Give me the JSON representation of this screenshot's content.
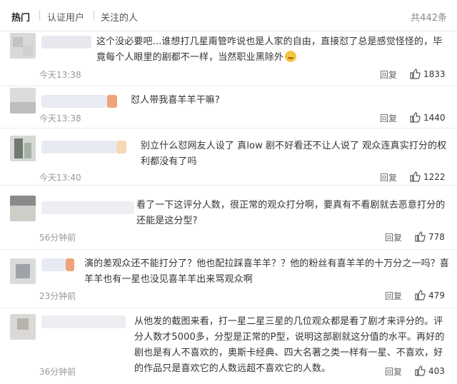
{
  "tabs": {
    "hot": "热门",
    "verified": "认证用户",
    "following": "关注的人",
    "total": "共442条"
  },
  "comments": [
    {
      "text": "这个没必要吧...谁想打几星甭管咋说也是人家的自由，直接怼了总是感觉怪怪的，毕竟每个人眼里的剧都不一样，当然职业黑除外",
      "time": "今天13:38",
      "reply": "回复",
      "likes": "1833",
      "emoji": "laughing-crying-emoji"
    },
    {
      "text": "怼人带我喜羊羊干嘛?",
      "time": "今天13:38",
      "reply": "回复",
      "likes": "1440"
    },
    {
      "text": "别立什么怼网友人设了 真low 剧不好看还不让人说了 观众连真实打分的权利都没有了吗",
      "time": "今天13:40",
      "reply": "回复",
      "likes": "1222"
    },
    {
      "text": "看了一下这评分人数，很正常的观众打分啊，要真有不看剧就去恶意打分的还能是这分型?",
      "time": "56分钟前",
      "reply": "回复",
      "likes": "778"
    },
    {
      "text": "演的差观众还不能打分了？他也配拉踩喜羊羊？？他的粉丝有喜羊羊的十万分之一吗？喜羊羊也有一星也没见喜羊羊出来骂观众啊",
      "time": "23分钟前",
      "reply": "回复",
      "likes": "479"
    },
    {
      "text": "从他发的截图来看，打一星二星三星的几位观众都是看了剧才来评分的。评分人数才5000多，分型是正常的P型，说明这部剧就这分值的水平。再好的剧也是有人不喜欢的，奥斯卡经典、四大名著之类一样有一星、不喜欢，好的作品只是喜欢它的人数远超不喜欢它的人数。",
      "time": "36分钟前",
      "reply": "回复",
      "likes": "403"
    }
  ],
  "colors": {
    "text": "#333333",
    "muted": "#999999",
    "divider": "#ececec"
  }
}
